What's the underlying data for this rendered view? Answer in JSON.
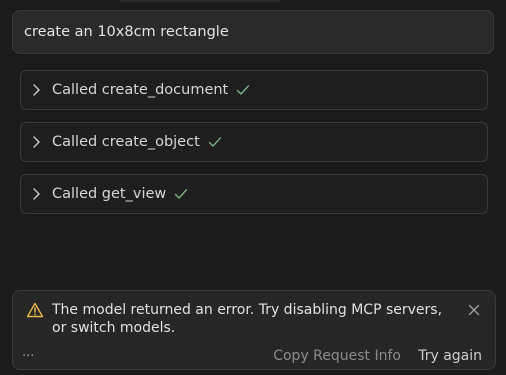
{
  "prompt": {
    "text": "create an 10x8cm rectangle"
  },
  "tool_calls": [
    {
      "label": "Called create_document",
      "icon": "chevron-right-icon",
      "status_icon": "checkmark-icon"
    },
    {
      "label": "Called create_object",
      "icon": "chevron-right-icon",
      "status_icon": "checkmark-icon"
    },
    {
      "label": "Called get_view",
      "icon": "chevron-right-icon",
      "status_icon": "checkmark-icon"
    }
  ],
  "error": {
    "icon": "warning-icon",
    "message": "The model returned an error. Try disabling MCP servers, or switch models.",
    "more_label": "...",
    "copy_label": "Copy Request Info",
    "retry_label": "Try again",
    "close_icon": "close-icon"
  },
  "colors": {
    "background": "#1b1b1b",
    "check": "#7fb98a",
    "warning": "#e6b84a"
  }
}
